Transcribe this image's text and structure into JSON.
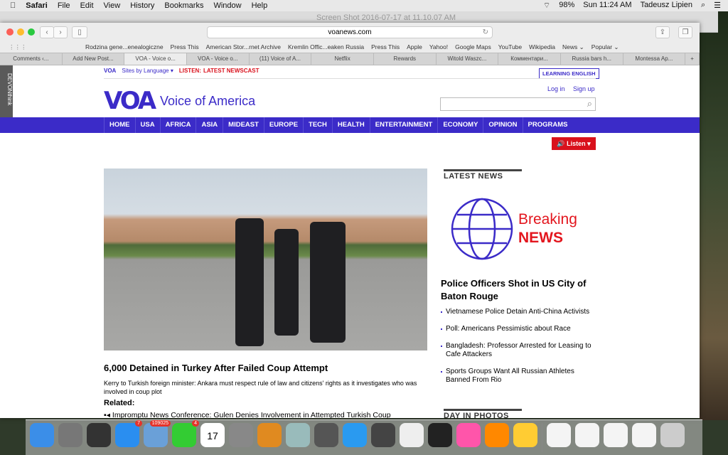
{
  "menubar": {
    "app": "Safari",
    "items": [
      "File",
      "Edit",
      "View",
      "History",
      "Bookmarks",
      "Window",
      "Help"
    ],
    "battery": "98%",
    "clock": "Sun 11:24 AM",
    "user": "Tadeusz Lipien"
  },
  "bg_window_title": "Screen Shot 2016-07-17 at 11.10.07 AM",
  "browser": {
    "url": "voanews.com",
    "bookmarks": [
      "Rodzina gene...enealogiczne",
      "Press This",
      "American Stor...rnet Archive",
      "Kremlin Offic...eaken Russia",
      "Press This",
      "Apple",
      "Yahoo!",
      "Google Maps",
      "YouTube",
      "Wikipedia",
      "News ⌄",
      "Popular ⌄"
    ],
    "tabs": [
      "Comments ‹...",
      "Add New Post...",
      "VOA - Voice o...",
      "VOA - Voice o...",
      "(11) Voice of A...",
      "Netflix",
      "Rewards",
      "Witold Waszc...",
      "Комментари...",
      "Russia bars h...",
      "Montessa Ap..."
    ],
    "active_tab": 2
  },
  "devon": "DEVONthink",
  "page": {
    "topbar": {
      "voa": "VOA",
      "sites": "Sites by Language ▾",
      "listen": "LISTEN:",
      "newscast": "LATEST NEWSCAST",
      "learning": "LEARNING ENGLISH"
    },
    "logo_mark": "VOA",
    "logo_text": "Voice of America",
    "login": "Log in",
    "signup": "Sign up",
    "nav": [
      "HOME",
      "USA",
      "AFRICA",
      "ASIA",
      "MIDEAST",
      "EUROPE",
      "TECH",
      "HEALTH",
      "ENTERTAINMENT",
      "ECONOMY",
      "OPINION",
      "PROGRAMS"
    ],
    "listen_button": "🔊 Listen ▾",
    "headline": "6,000 Detained in Turkey After Failed Coup Attempt",
    "summary": "Kerry to Turkish foreign minister: Ankara must respect rule of law and citizens' rights as it investigates who was involved in coup plot",
    "related": "Related:",
    "related_items": [
      "Impromptu News Conference: Gulen Denies Involvement in Attempted Turkish Coup"
    ],
    "latest_news": "LATEST NEWS",
    "breaking": [
      "Breaking",
      "NEWS"
    ],
    "lead": "Police Officers Shot in US City of Baton Rouge",
    "news": [
      "Vietnamese Police Detain Anti-China Activists",
      "Poll: Americans Pessimistic about Race",
      "Bangladesh: Professor Arrested for Leasing to Cafe Attackers",
      "Sports Groups Want All Russian Athletes Banned From Rio"
    ],
    "day_in_photos": "DAY IN PHOTOS"
  },
  "dock": {
    "badges": {
      "appstore": "7",
      "mail": "109025",
      "facetime": "4"
    },
    "calendar_day": "17"
  },
  "colors": {
    "brand": "#3b2bc8",
    "listen_red": "#d9111c",
    "breaking_red": "#e3161e"
  }
}
